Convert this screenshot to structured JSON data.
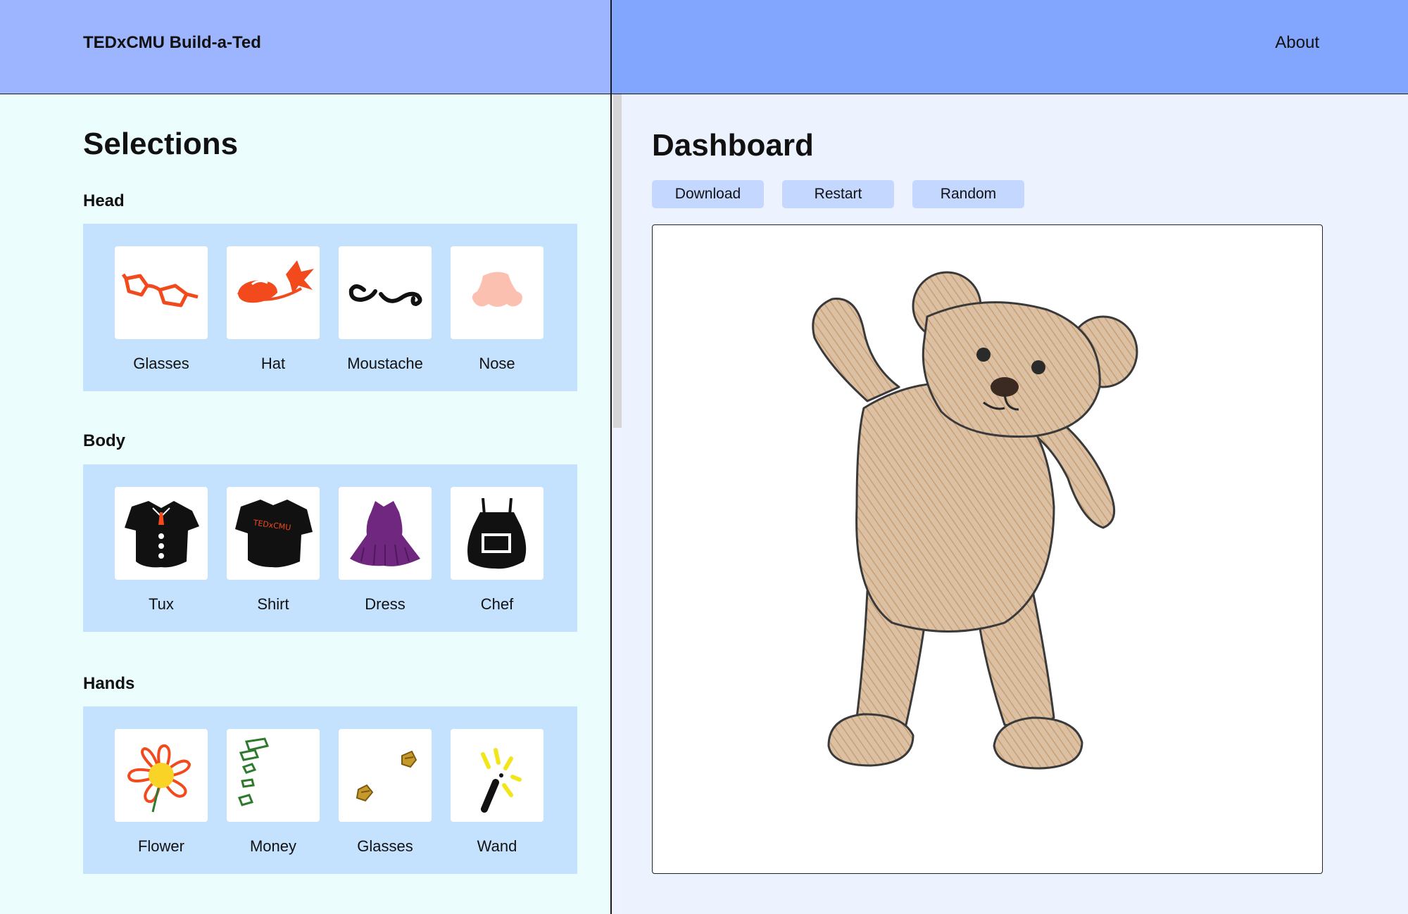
{
  "header": {
    "app_title": "TEDxCMU Build-a-Ted",
    "about_label": "About"
  },
  "selections": {
    "title": "Selections",
    "sections": [
      {
        "label": "Head",
        "items": [
          "Glasses",
          "Hat",
          "Moustache",
          "Nose"
        ]
      },
      {
        "label": "Body",
        "items": [
          "Tux",
          "Shirt",
          "Dress",
          "Chef"
        ]
      },
      {
        "label": "Hands",
        "items": [
          "Flower",
          "Money",
          "Glasses",
          "Wand"
        ]
      }
    ],
    "shirt_print": "TEDxCMU"
  },
  "dashboard": {
    "title": "Dashboard",
    "buttons": [
      "Download",
      "Restart",
      "Random"
    ]
  },
  "colors": {
    "header_left": "#9db4fe",
    "header_right": "#82a5fd",
    "left_panel": "#ecfdfe",
    "right_panel": "#ecf2fe",
    "section_box": "#c4e1fe",
    "button": "#c4d7ff",
    "accent_red": "#f24a1d",
    "bear_fill": "#d5b08c"
  }
}
